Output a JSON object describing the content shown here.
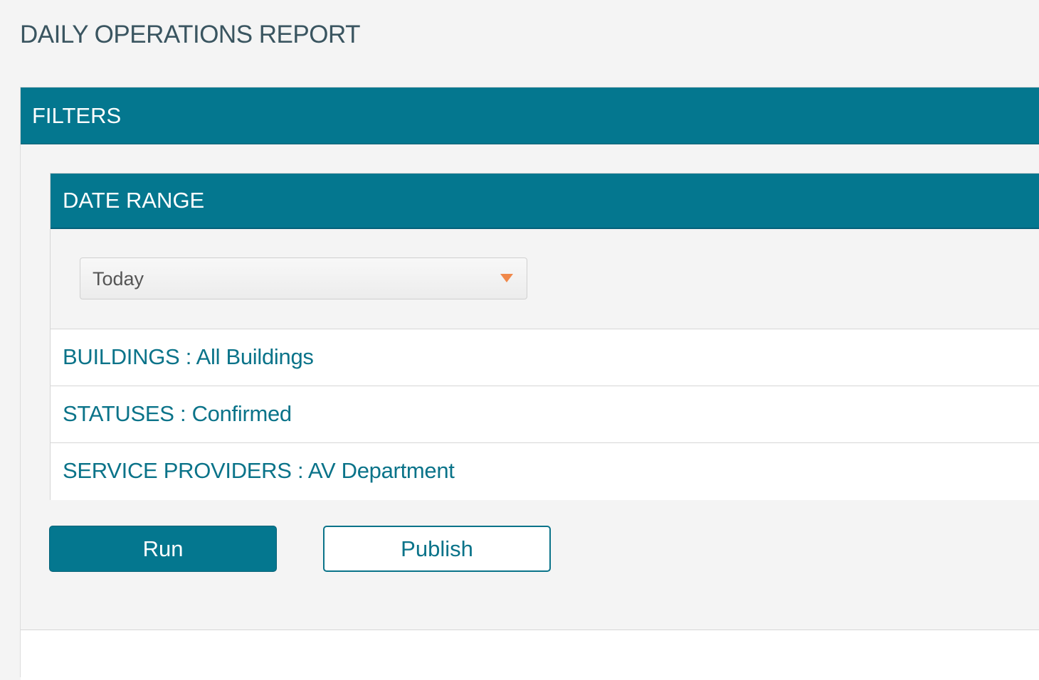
{
  "page": {
    "title": "DAILY OPERATIONS REPORT"
  },
  "filters": {
    "header": "FILTERS",
    "date_range": {
      "header": "DATE RANGE",
      "select": {
        "value": "Today",
        "icon": "chevron-down-icon"
      }
    },
    "rows": [
      {
        "label": "BUILDINGS : All Buildings"
      },
      {
        "label": "STATUSES : Confirmed"
      },
      {
        "label": "SERVICE PROVIDERS : AV Department"
      }
    ]
  },
  "actions": {
    "run_label": "Run",
    "publish_label": "Publish"
  },
  "colors": {
    "primary": "#04778f",
    "link_text": "#0a7389",
    "accent_arrow": "#f0884a",
    "background": "#f4f4f4",
    "title_text": "#3a5560"
  }
}
